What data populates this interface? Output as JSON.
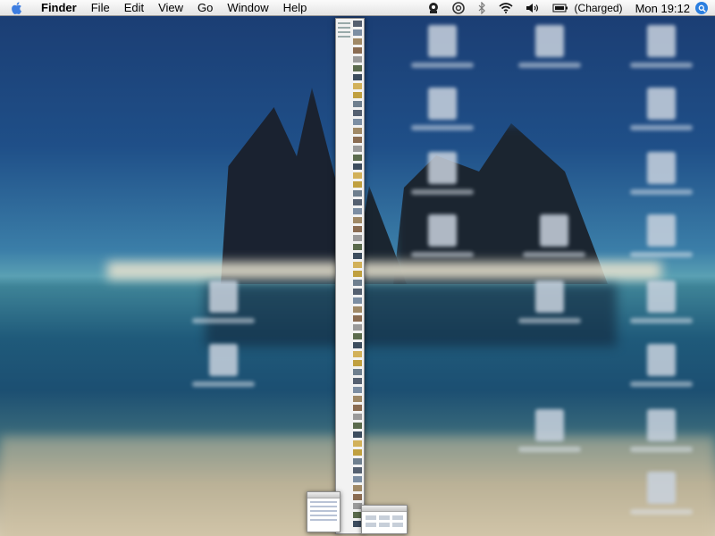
{
  "menubar": {
    "app_name": "Finder",
    "menus": [
      "File",
      "Edit",
      "View",
      "Go",
      "Window",
      "Help"
    ],
    "battery_status": "(Charged)",
    "clock": "Mon 19:12"
  },
  "icons": {
    "apple": "apple-icon",
    "script_menu": "script-icon",
    "sync": "sync-icon",
    "bluetooth": "bluetooth-icon",
    "wifi": "wifi-icon",
    "volume": "volume-icon",
    "battery": "battery-icon",
    "spotlight": "spotlight-icon"
  },
  "colors": {
    "menubar": "#ececec",
    "spotlight": "#2b7fe0"
  }
}
